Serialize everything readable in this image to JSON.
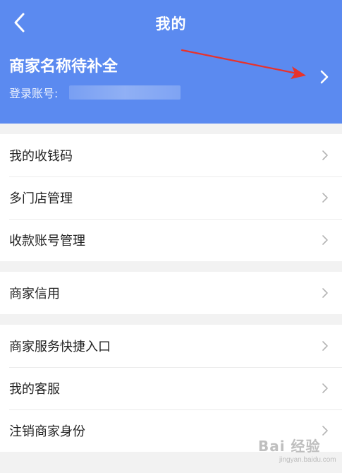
{
  "header": {
    "title": "我的",
    "merchant_name": "商家名称待补全",
    "account_label": "登录账号:",
    "background_color": "#5b8af0"
  },
  "icons": {
    "back": "back-chevron-icon",
    "profile_arrow": "chevron-right-icon",
    "row_arrow": "chevron-right-icon",
    "annotation": "red-arrow-annotation"
  },
  "menu_groups": [
    {
      "items": [
        {
          "label": "我的收钱码"
        },
        {
          "label": "多门店管理"
        },
        {
          "label": "收款账号管理"
        }
      ]
    },
    {
      "items": [
        {
          "label": "商家信用"
        }
      ]
    },
    {
      "items": [
        {
          "label": "商家服务快捷入口"
        },
        {
          "label": "我的客服"
        },
        {
          "label": "注销商家身份"
        }
      ]
    }
  ],
  "watermark": {
    "text": "Bai 经验",
    "sub": "jingyan.baidu.com"
  }
}
